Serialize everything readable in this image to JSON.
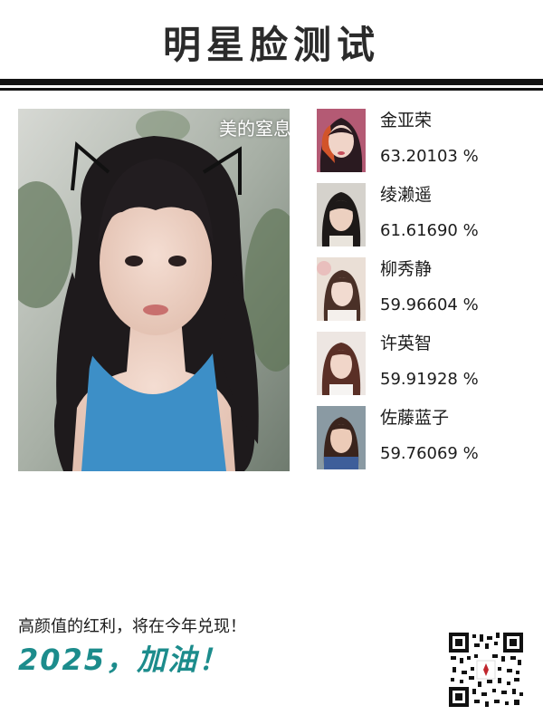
{
  "header": {
    "title": "明星脸测试"
  },
  "photo": {
    "caption": "美的窒息"
  },
  "results": [
    {
      "name": "金亚荣",
      "score": "63.20103 %"
    },
    {
      "name": "绫濑遥",
      "score": "61.61690 %"
    },
    {
      "name": "柳秀静",
      "score": "59.96604 %"
    },
    {
      "name": "许英智",
      "score": "59.91928 %"
    },
    {
      "name": "佐藤蓝子",
      "score": "59.76069 %"
    }
  ],
  "footer": {
    "slogan": "高颜值的红利，将在今年兑现！",
    "year_line": "2025，加油！"
  },
  "colors": {
    "accent": "#1c8c8c",
    "rule": "#141414",
    "text": "#1c1c1c"
  },
  "icons": {
    "qr": "qr-code-icon"
  }
}
